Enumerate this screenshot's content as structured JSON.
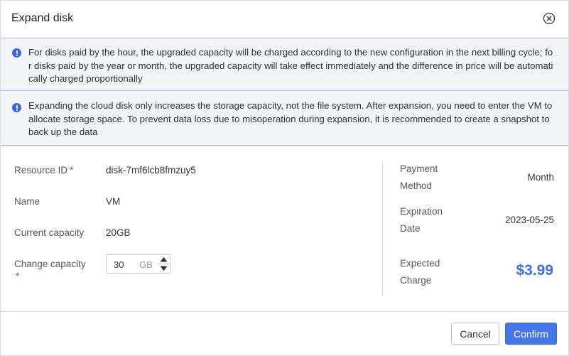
{
  "dialog": {
    "title": "Expand disk",
    "close_icon": "close-circle-icon"
  },
  "notices": [
    {
      "icon": "info-circle-icon",
      "text": "For disks paid by the hour, the upgraded capacity will be charged according to the new configuration in the next billing cycle; for disks paid by the year or month, the upgraded capacity will take effect immediately and the difference in price will be automatically charged proportionally"
    },
    {
      "icon": "info-circle-icon",
      "text": "Expanding the cloud disk only increases the storage capacity, not the file system. After expansion, you need to enter the VM to allocate storage space. To prevent data loss due to misoperation during expansion, it is recommended to create a snapshot to back up the data"
    }
  ],
  "form": {
    "resource_id": {
      "label": "Resource ID",
      "required_mark": "*",
      "value": "disk-7mf6lcb8fmzuy5"
    },
    "name": {
      "label": "Name",
      "value": "VM"
    },
    "current_capacity": {
      "label": "Current capacity",
      "value": "20GB"
    },
    "change_capacity": {
      "label": "Change capacity",
      "required_mark": "*",
      "value": "30",
      "unit": "GB"
    }
  },
  "summary": {
    "payment_method": {
      "label": "Payment Method",
      "value": "Month"
    },
    "expiration_date": {
      "label": "Expiration Date",
      "value": "2023-05-25"
    },
    "expected_charge": {
      "label": "Expected Charge",
      "value": "$3.99"
    }
  },
  "footer": {
    "cancel_label": "Cancel",
    "confirm_label": "Confirm"
  },
  "colors": {
    "accent": "#4577e8",
    "price": "#3d6ee8",
    "required": "#e0352c",
    "info_icon": "#3d66d9"
  }
}
